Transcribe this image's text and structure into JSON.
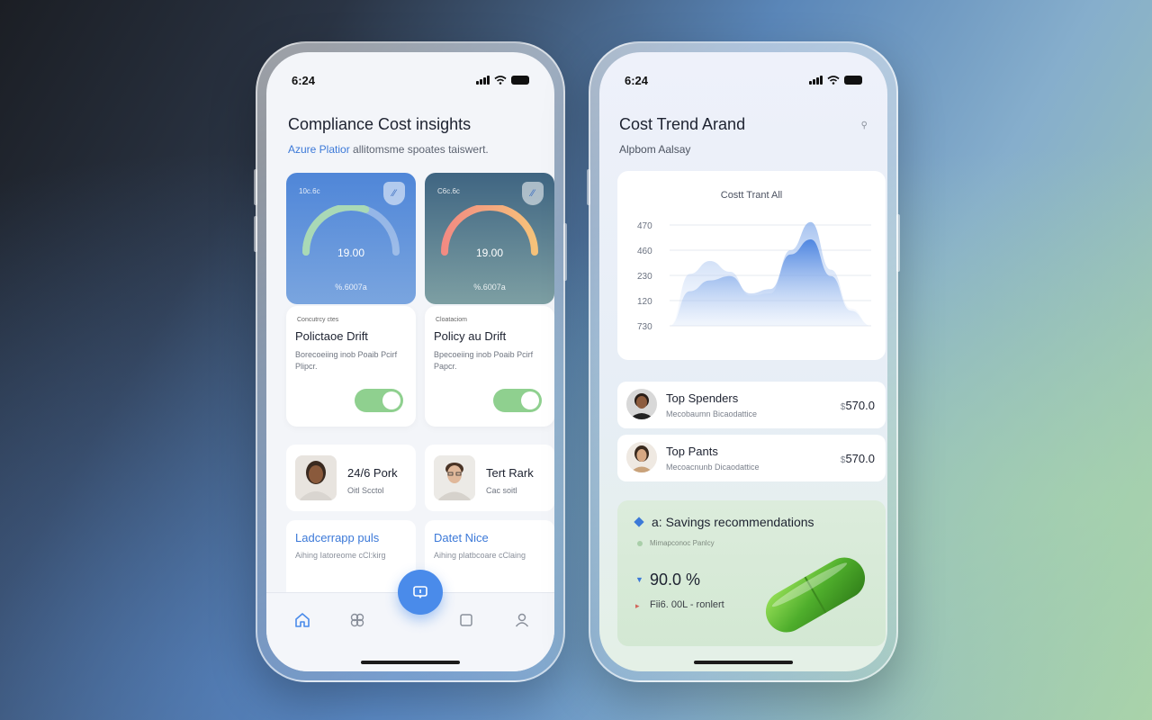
{
  "left_phone": {
    "status": {
      "time": "6:24"
    },
    "title": "Compliance Cost insights",
    "subtitle_accent": "Azure Platior",
    "subtitle_rest": " allitomsme spoates taiswert.",
    "gauges": [
      {
        "code": "10c.6c",
        "value": "19.00",
        "footer": "%.6007a",
        "level": 0.55
      },
      {
        "code": "C6c.6c",
        "value": "19.00",
        "footer": "%.6007a",
        "level": 0.85
      }
    ],
    "policies": [
      {
        "kicker": "Concutrcy ctes",
        "title": "Polictaoe Drift",
        "desc": "Borecoeiing inob Poaib Pcirf Plipcr.",
        "enabled": true
      },
      {
        "kicker": "Cloataciom",
        "title": "Policy au Drift",
        "desc": "Bpecoeiing inob Poaib Pcirf Papcr.",
        "enabled": true
      }
    ],
    "people": [
      {
        "name": "24/6 Pork",
        "sub": "Oitl Scctol"
      },
      {
        "name": "Tert Rark",
        "sub": "Cac soitl"
      }
    ],
    "links": [
      {
        "title": "Ladcerrapp puls",
        "sub": "Aihing Iatoreome cCl:kirg"
      },
      {
        "title": "Datet Nice",
        "sub": "Aihing platbcoare cClaing"
      }
    ],
    "tabs": [
      "home-icon",
      "apps-icon",
      "chat-icon",
      "square-icon",
      "user-icon"
    ]
  },
  "right_phone": {
    "status": {
      "time": "6:24"
    },
    "title": "Cost Trend Arand",
    "subtitle": "Alpbom Aalsay",
    "chart_data": {
      "type": "area",
      "title": "Costt Trant All",
      "y_ticks": [
        "470",
        "460",
        "230",
        "120",
        "730"
      ],
      "x": [
        0,
        1,
        2,
        3,
        4,
        5,
        6,
        7,
        8,
        9,
        10
      ],
      "series": [
        {
          "values": [
            0,
            240,
            300,
            250,
            140,
            150,
            350,
            480,
            260,
            80,
            0
          ]
        },
        {
          "values": [
            0,
            160,
            210,
            230,
            150,
            170,
            330,
            400,
            230,
            70,
            0
          ]
        }
      ]
    },
    "spenders": [
      {
        "name": "Top Spenders",
        "sub": "Mecobaumn Bicaodattice",
        "currency": "$",
        "amount": "570.0"
      },
      {
        "name": "Top Pants",
        "sub": "Mecoacnunb Dicaodattice",
        "currency": "$",
        "amount": "570.0"
      }
    ],
    "savings": {
      "title": "Savings recommendations",
      "title_prefix": "a:",
      "note": "Mimapconoc Panlcy",
      "percent": "90.0 %",
      "row": "Fii6. 00L - ronlert"
    }
  },
  "colors": {
    "accent": "#3c79d8",
    "toggle_on": "#8fd08f",
    "fab": "#4a8bea",
    "chart_fill": "#5b8fe0"
  }
}
